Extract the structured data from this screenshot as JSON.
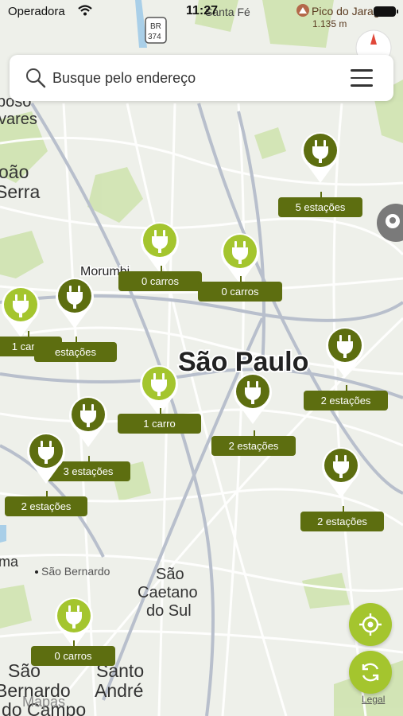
{
  "status_bar": {
    "carrier": "Operadora",
    "time": "11:27"
  },
  "search": {
    "placeholder": "Busque pelo endereço"
  },
  "map_labels": {
    "city": "São Paulo",
    "morumbi": "Morumbi",
    "sao_bernardo": "São Bernardo",
    "sao_caetano_1": "São",
    "sao_caetano_2": "Caetano",
    "sao_caetano_3": "do Sul",
    "santo_andre_1": "Santo",
    "santo_andre_2": "André",
    "sb_campo_1": "São",
    "sb_campo_2": "Bernardo",
    "sb_campo_3": "do Campo",
    "pico": "Pico do Jaraguá",
    "pico_elev": "1.135 m",
    "santa_fe": "Santa Fé",
    "br_shield_1": "BR",
    "br_shield_2": "374",
    "left_1": "poso",
    "left_2": "vares",
    "left_3": "oão",
    "left_4": "Serra",
    "left_5": "ma",
    "mapas": "Mapas"
  },
  "markers": [
    {
      "label": "5 estações",
      "kind": "station"
    },
    {
      "label": "0 carros",
      "kind": "car"
    },
    {
      "label": "0 carros",
      "kind": "car"
    },
    {
      "label": "1 carro",
      "kind": "car"
    },
    {
      "label": "estações",
      "kind": "station"
    },
    {
      "label": "2 estações",
      "kind": "station"
    },
    {
      "label": "1 carro",
      "kind": "car"
    },
    {
      "label": "2 estações",
      "kind": "station"
    },
    {
      "label": "3 estações",
      "kind": "station"
    },
    {
      "label": "2 estações",
      "kind": "station"
    },
    {
      "label": "2 estações",
      "kind": "station"
    },
    {
      "label": "0 carros",
      "kind": "car"
    }
  ],
  "buttons": {
    "legal": "Legal"
  },
  "colors": {
    "station_marker": "#5d6e10",
    "car_marker": "#a4c52e",
    "label_bg": "#5d6e10",
    "fab_bg": "#a4c52e"
  }
}
